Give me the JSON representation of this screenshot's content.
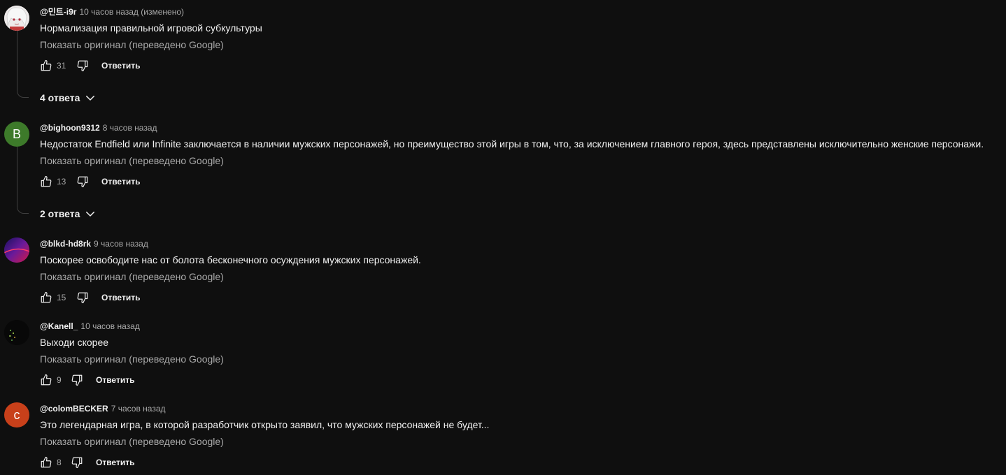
{
  "comments": [
    {
      "author": "@민트-i9r",
      "time": "10 часов назад (изменено)",
      "text": "Нормализация правильной игровой субкультуры",
      "translate": "Показать оригинал (переведено Google)",
      "likes": "31",
      "reply": "Ответить",
      "replies": "4 ответа",
      "avatar_letter": "",
      "avatar_color": "#e8e4e4"
    },
    {
      "author": "@bighoon9312",
      "time": "8 часов назад",
      "text": "Недостаток Endfield или Infinite заключается в наличии мужских персонажей, но преимущество этой игры в том, что, за исключением главного героя, здесь представлены исключительно женские персонажи.",
      "translate": "Показать оригинал (переведено Google)",
      "likes": "13",
      "reply": "Ответить",
      "replies": "2 ответа",
      "avatar_letter": "B",
      "avatar_color": "#3d7a2a"
    },
    {
      "author": "@blkd-hd8rk",
      "time": "9 часов назад",
      "text": "Поскорее освободите нас от болота бесконечного осуждения мужских персонажей.",
      "translate": "Показать оригинал (переведено Google)",
      "likes": "15",
      "reply": "Ответить",
      "avatar_letter": "",
      "avatar_color": "#3a1a6e"
    },
    {
      "author": "@Kanell_",
      "time": "10 часов назад",
      "text": "Выходи скорее",
      "translate": "Показать оригинал (переведено Google)",
      "likes": "9",
      "reply": "Ответить",
      "avatar_letter": "",
      "avatar_color": "#0a0a0a"
    },
    {
      "author": "@colomBECKER",
      "time": "7 часов назад",
      "text": "Это легендарная игра, в которой разработчик открыто заявил, что мужских персонажей не будет...",
      "translate": "Показать оригинал (переведено Google)",
      "likes": "8",
      "reply": "Ответить",
      "avatar_letter": "c",
      "avatar_color": "#c8401a"
    }
  ],
  "icons": {
    "like": "thumbs-up-icon",
    "dislike": "thumbs-down-icon",
    "expand": "chevron-down-icon"
  }
}
